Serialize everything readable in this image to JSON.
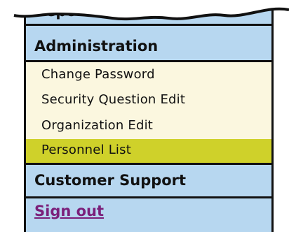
{
  "nav": {
    "reports_label": "Reports",
    "administration_label": "Administration",
    "admin_items": [
      {
        "label": "Change Password"
      },
      {
        "label": "Security Question Edit"
      },
      {
        "label": "Organization Edit"
      },
      {
        "label": "Personnel List",
        "selected": true
      }
    ],
    "customer_support_label": "Customer Support",
    "signout_label": "Sign out"
  },
  "colors": {
    "section_bg": "#b7d7f0",
    "submenu_bg": "#fbf7df",
    "selected_bg": "#cfd12a",
    "signout_link": "#7b1f7a"
  }
}
